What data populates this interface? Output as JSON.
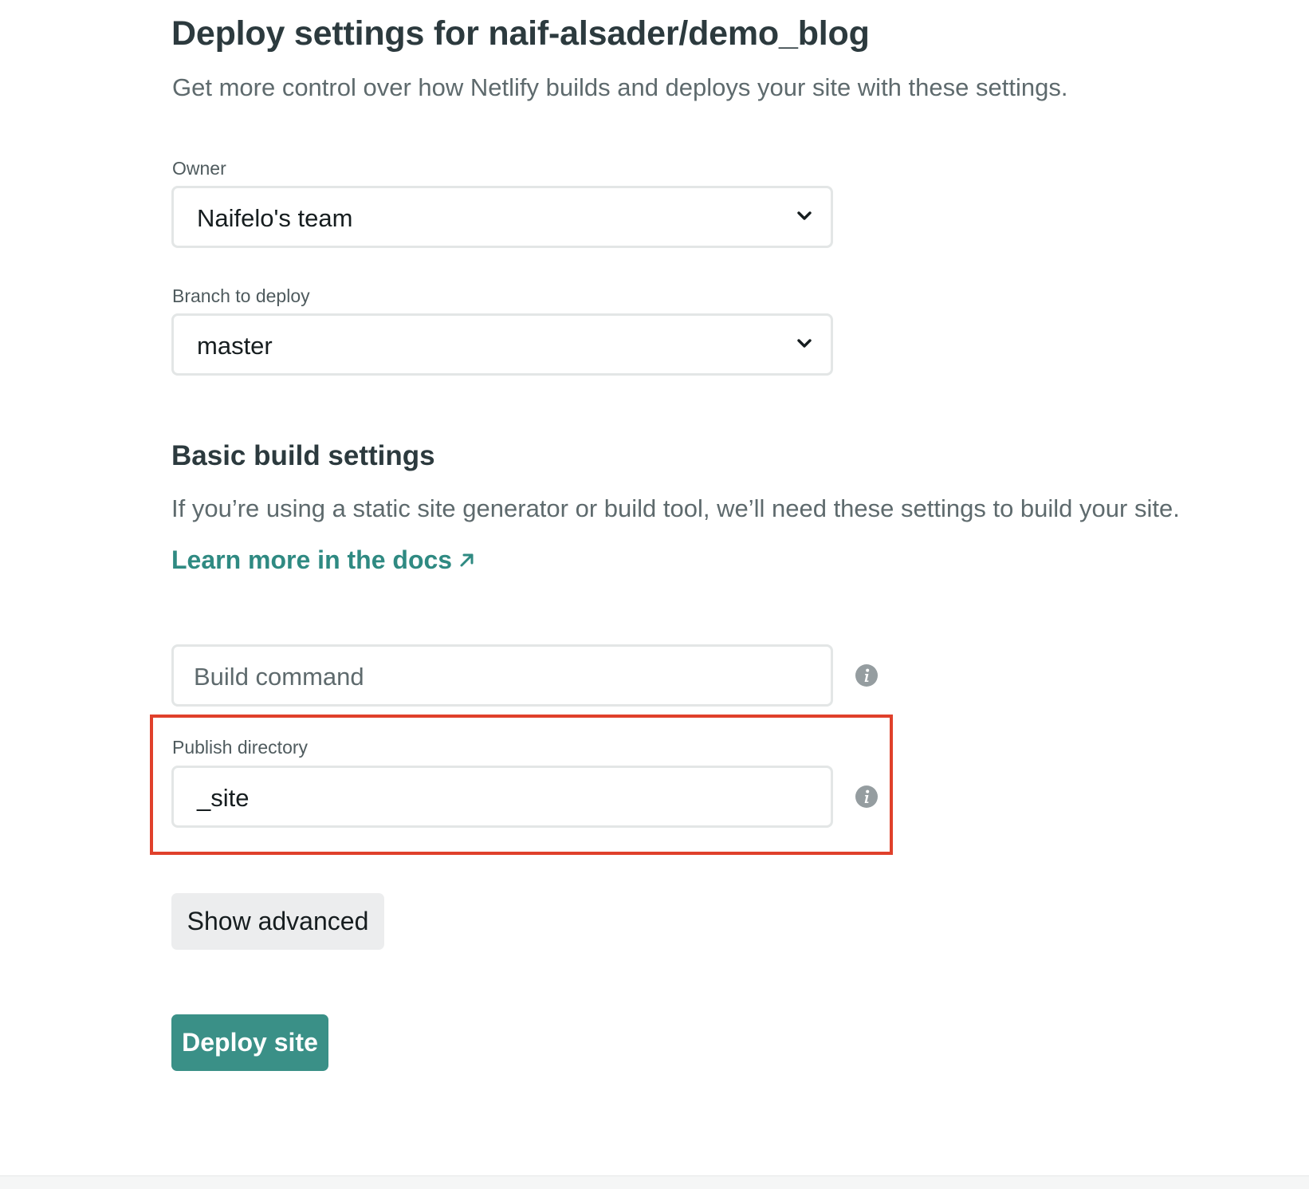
{
  "header": {
    "title": "Deploy settings for naif-alsader/demo_blog",
    "subtitle": "Get more control over how Netlify builds and deploys your site with these settings."
  },
  "owner": {
    "label": "Owner",
    "selected": "Naifelo's team"
  },
  "branch": {
    "label": "Branch to deploy",
    "selected": "master"
  },
  "build_settings": {
    "title": "Basic build settings",
    "description": "If you’re using a static site generator or build tool, we’ll need these settings to build your site.",
    "docs_link": "Learn more in the docs",
    "build_command": {
      "placeholder": "Build command",
      "value": ""
    },
    "publish_directory": {
      "label": "Publish directory",
      "value": "_site"
    }
  },
  "buttons": {
    "show_advanced": "Show advanced",
    "deploy_site": "Deploy site"
  },
  "colors": {
    "accent": "#3a9087",
    "link": "#2f8a82",
    "highlight": "#e0402b",
    "heading": "#2c3a3e"
  },
  "icons": {
    "chevron": "chevron-down-icon",
    "external": "external-link-arrow-icon",
    "info": "info-icon"
  }
}
